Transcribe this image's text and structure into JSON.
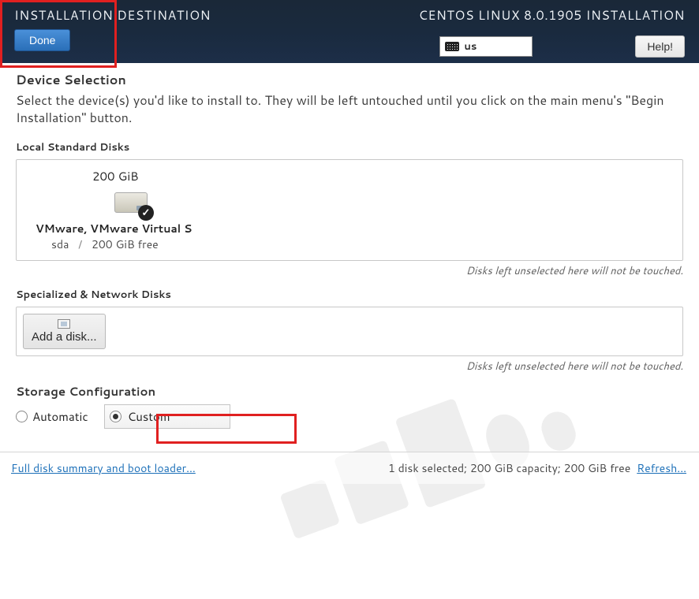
{
  "header": {
    "title": "INSTALLATION DESTINATION",
    "subtitle": "CENTOS LINUX 8.0.1905 INSTALLATION",
    "done_label": "Done",
    "keyboard_layout": "us",
    "help_label": "Help!"
  },
  "device_selection": {
    "title": "Device Selection",
    "description": "Select the device(s) you'd like to install to.  They will be left untouched until you click on the main menu's \"Begin Installation\" button."
  },
  "local_disks": {
    "label": "Local Standard Disks",
    "disk": {
      "size": "200 GiB",
      "name": "VMware, VMware Virtual S",
      "device": "sda",
      "free": "200 GiB free",
      "selected": true
    },
    "unselected_note": "Disks left unselected here will not be touched."
  },
  "network_disks": {
    "label": "Specialized & Network Disks",
    "add_button": "Add a disk...",
    "unselected_note": "Disks left unselected here will not be touched."
  },
  "storage_config": {
    "title": "Storage Configuration",
    "automatic_label": "Automatic",
    "custom_label": "Custom",
    "selected": "custom"
  },
  "footer": {
    "summary_link": "Full disk summary and boot loader...",
    "status": "1 disk selected; 200 GiB capacity; 200 GiB free",
    "refresh_link": "Refresh..."
  }
}
